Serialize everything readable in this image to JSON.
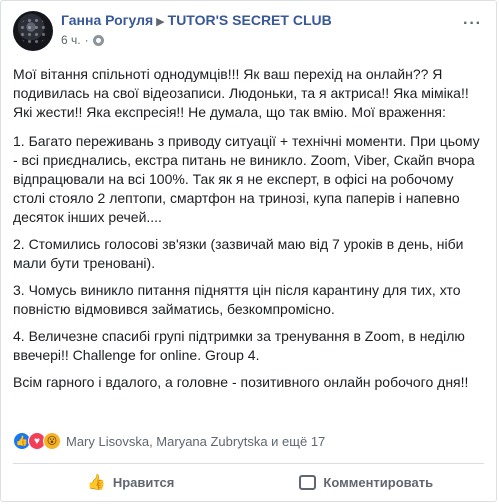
{
  "post": {
    "author": "Ганна Рогуля",
    "group": "TUTOR'S SECRET CLUB",
    "time": "6 ч.",
    "more_label": "···",
    "paragraphs": [
      "Мої вітання спільноті однодумців!!! Як ваш перехід на онлайн?? Я подивилась на свої відеозаписи. Людоньки, та я актриса!! Яка міміка!! Які жести!! Яка експресія!! Не думала, що так вмію. Мої враження:",
      "1. Багато переживань з приводу ситуації + технічні моменти. При цьому - всі приєднались, екстра питань не виникло. Zoom, Viber, Скайп вчора відпрацювали на всі 100%. Так як я не експерт, в офісі на робочому столі стояло 2 лептопи, смартфон на тринозі, купа паперів і напевно десяток інших речей....",
      "2. Стомились голосові зв'язки (зазвичай маю від 7 уроків в день, ніби мали бути треновані).",
      "3. Чомусь виникло питання підняття цін після карантину для тих, хто повністю відмовився займатись, безкомпромісно.",
      "4. Величезне спасибі групі підтримки за тренування в Zoom, в неділю ввечері!! Challenge for online. Group 4.",
      "Всім гарного і вдалого, а головне - позитивного онлайн робочого дня!!"
    ]
  },
  "reactions": {
    "icons": [
      "like-icon",
      "love-icon",
      "wow-icon"
    ],
    "names": "Mary Lisovska, Maryana Zubrytska и ещё 17"
  },
  "actions": {
    "like_label": "Нравится",
    "comment_label": "Комментировать"
  },
  "colors": {
    "link": "#385898",
    "secondary": "#606770",
    "like": "#1877f2",
    "love": "#f33e58",
    "wow": "#f7b125"
  }
}
